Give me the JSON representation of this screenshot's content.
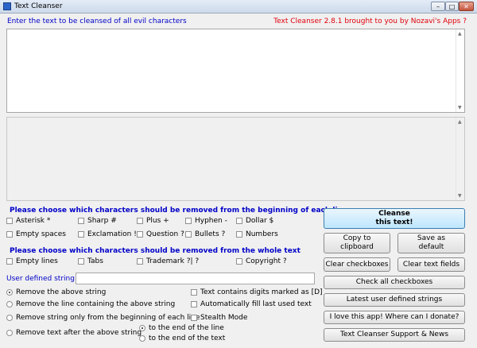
{
  "window": {
    "title": "Text Cleanser"
  },
  "header": {
    "instruction": "Enter the text to be cleansed of all evil characters",
    "brand": "Text Cleanser 2.8.1 brought to you by Nozavi's Apps ?"
  },
  "input_text": "",
  "output_text": "",
  "section_begin": {
    "title": "Please choose which characters should be removed from the beginning of each line",
    "options": [
      {
        "label": "Asterisk *",
        "checked": false
      },
      {
        "label": "Sharp #",
        "checked": false
      },
      {
        "label": "Plus +",
        "checked": false
      },
      {
        "label": "Hyphen -",
        "checked": false
      },
      {
        "label": "Dollar $",
        "checked": false
      },
      {
        "label": "Empty spaces",
        "checked": false
      },
      {
        "label": "Exclamation !",
        "checked": false
      },
      {
        "label": "Question ?",
        "checked": false
      },
      {
        "label": "Bullets ?",
        "checked": false
      },
      {
        "label": "Numbers",
        "checked": false
      }
    ]
  },
  "section_whole": {
    "title": "Please choose which characters should be removed from the whole text",
    "options": [
      {
        "label": "Empty lines",
        "checked": false
      },
      {
        "label": "Tabs",
        "checked": false
      },
      {
        "label": "Trademark ?| ?",
        "checked": false
      },
      {
        "label": "Copyright ?",
        "checked": false
      }
    ]
  },
  "user_defined": {
    "label": "User defined string:",
    "value": ""
  },
  "radios": [
    {
      "label": "Remove the above string",
      "selected": true
    },
    {
      "label": "Remove the line containing the above string",
      "selected": false
    },
    {
      "label": "Remove string only from the beginning of each line",
      "selected": false
    },
    {
      "label": "Remove text after the above string",
      "selected": false
    }
  ],
  "sub_radios": [
    {
      "label": "to the end of the line",
      "selected": true
    },
    {
      "label": "to the end of the text",
      "selected": false
    }
  ],
  "extra_options": [
    {
      "label": "Text contains digits marked as [D]",
      "checked": false
    },
    {
      "label": "Automatically fill last used text",
      "checked": false
    },
    {
      "label": "Stealth Mode",
      "checked": false
    }
  ],
  "buttons": {
    "cleanse": "Cleanse\nthis text!",
    "copy": "Copy to\nclipboard",
    "save_default": "Save as\ndefault",
    "clear_checkboxes": "Clear checkboxes",
    "clear_fields": "Clear text fields",
    "check_all": "Check all checkboxes",
    "latest_strings": "Latest user defined strings",
    "donate": "I love this app! Where can I donate?",
    "support": "Text Cleanser Support & News"
  }
}
